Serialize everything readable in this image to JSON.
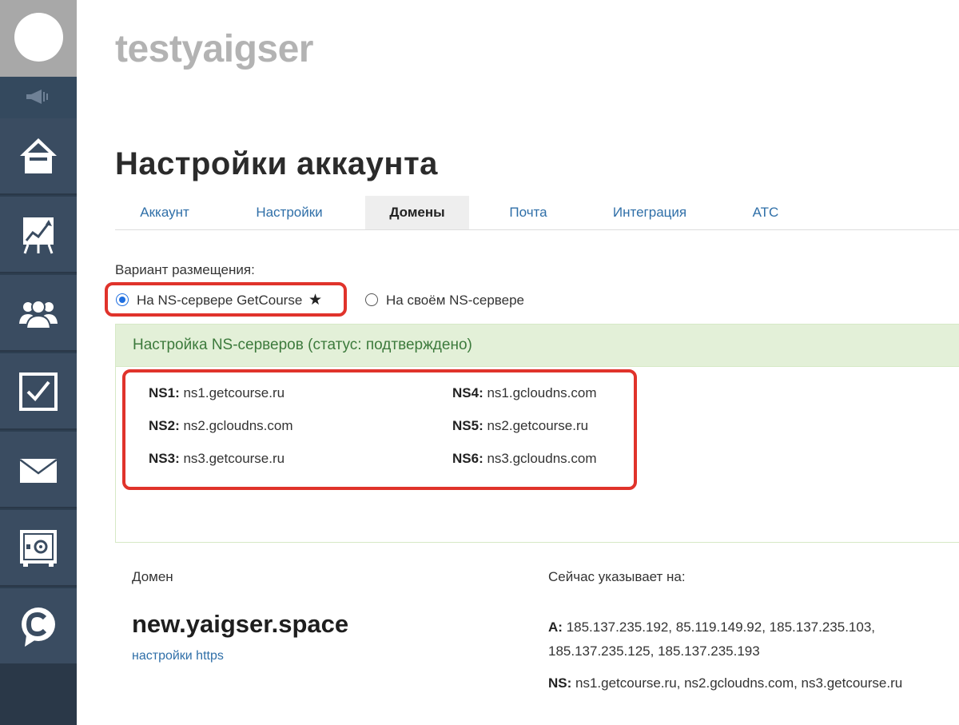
{
  "header": {
    "school_name": "testyaigser",
    "page_title": "Настройки аккаунта"
  },
  "tabs": [
    {
      "label": "Аккаунт",
      "active": false
    },
    {
      "label": "Настройки",
      "active": false
    },
    {
      "label": "Домены",
      "active": true
    },
    {
      "label": "Почта",
      "active": false
    },
    {
      "label": "Интеграция",
      "active": false
    },
    {
      "label": "АТС",
      "active": false
    }
  ],
  "placement": {
    "label": "Вариант размещения:",
    "options": [
      {
        "label": "На NS-сервере GetCourse",
        "checked": true,
        "star": "★"
      },
      {
        "label": "На своём NS-сервере",
        "checked": false
      }
    ]
  },
  "ns_panel": {
    "header": "Настройка NS-серверов (статус: подтверждено)",
    "servers": [
      {
        "key": "NS1:",
        "value": "ns1.getcourse.ru"
      },
      {
        "key": "NS2:",
        "value": "ns2.gcloudns.com"
      },
      {
        "key": "NS3:",
        "value": "ns3.getcourse.ru"
      },
      {
        "key": "NS4:",
        "value": "ns1.gcloudns.com"
      },
      {
        "key": "NS5:",
        "value": "ns2.getcourse.ru"
      },
      {
        "key": "NS6:",
        "value": "ns3.gcloudns.com"
      }
    ]
  },
  "domain": {
    "column_label": "Домен",
    "name": "new.yaigser.space",
    "https_link": "настройки https",
    "points_label": "Сейчас указывает на:",
    "a_key": "A:",
    "a_line1": "185.137.235.192, 85.119.149.92, 185.137.235.103,",
    "a_line2": "185.137.235.125, 185.137.235.193",
    "ns_key": "NS:",
    "ns_value": "ns1.getcourse.ru, ns2.gcloudns.com, ns3.getcourse.ru"
  },
  "sidebar": {
    "items": [
      "home-icon",
      "chart-icon",
      "users-icon",
      "tasks-icon",
      "mail-icon",
      "safe-icon",
      "chat-icon"
    ]
  },
  "colors": {
    "sidebar": "#2d3e50",
    "link": "#2f6fa8",
    "highlight": "#e0332b",
    "panel_header_bg": "#e3f0d8",
    "panel_header_text": "#3c7a3c"
  }
}
